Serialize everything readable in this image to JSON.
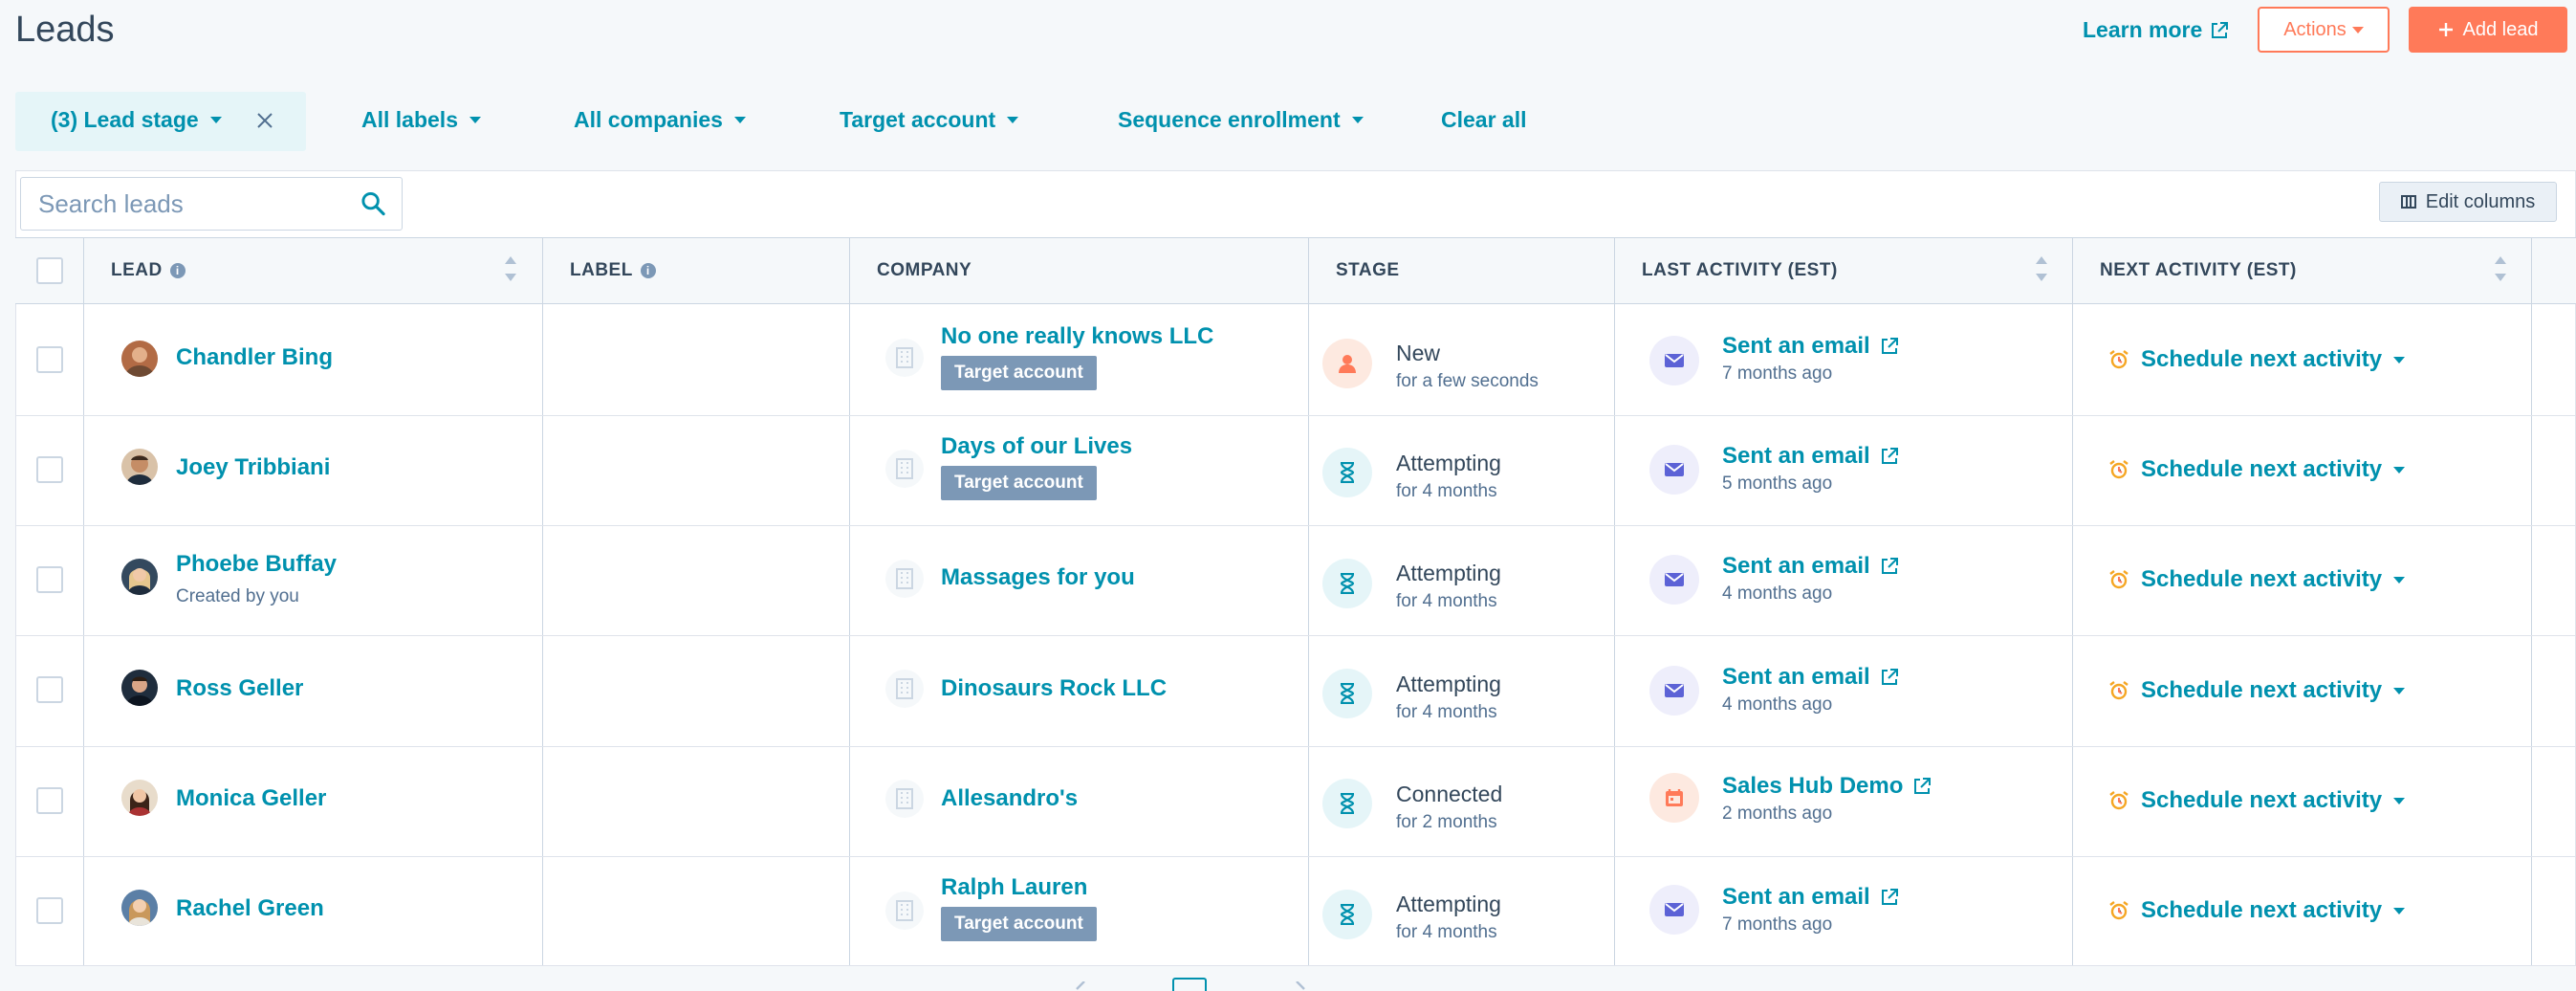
{
  "page": {
    "title": "Leads"
  },
  "header": {
    "learn_more": "Learn more",
    "actions": "Actions",
    "add_lead": "Add lead"
  },
  "filters": {
    "lead_stage": "(3) Lead stage",
    "all_labels": "All labels",
    "all_companies": "All companies",
    "target_account": "Target account",
    "sequence_enrollment": "Sequence enrollment",
    "clear_all": "Clear all"
  },
  "search": {
    "placeholder": "Search leads"
  },
  "toolbar": {
    "edit_columns": "Edit columns"
  },
  "columns": {
    "lead": "LEAD",
    "label": "LABEL",
    "company": "COMPANY",
    "stage": "STAGE",
    "last_activity": "LAST ACTIVITY (EST)",
    "next_activity": "NEXT ACTIVITY (EST)"
  },
  "colors": {
    "accent": "#0091ae",
    "brand": "#ff7a59",
    "tag": "#7c98b6"
  },
  "rows": [
    {
      "name": "Chandler Bing",
      "sub": "",
      "company": "No one really knows LLC",
      "tag": "Target account",
      "stage": "New",
      "stage_time": "for a few seconds",
      "stage_icon": "person-icon",
      "activity": "Sent an email",
      "activity_time": "7 months ago",
      "activity_icon": "email-icon",
      "next": "Schedule next activity"
    },
    {
      "name": "Joey Tribbiani",
      "sub": "",
      "company": "Days of our Lives",
      "tag": "Target account",
      "stage": "Attempting",
      "stage_time": "for 4 months",
      "stage_icon": "hourglass-icon",
      "activity": "Sent an email",
      "activity_time": "5 months ago",
      "activity_icon": "email-icon",
      "next": "Schedule next activity"
    },
    {
      "name": "Phoebe Buffay",
      "sub": "Created by you",
      "company": "Massages for you",
      "tag": "",
      "stage": "Attempting",
      "stage_time": "for 4 months",
      "stage_icon": "hourglass-icon",
      "activity": "Sent an email",
      "activity_time": "4 months ago",
      "activity_icon": "email-icon",
      "next": "Schedule next activity"
    },
    {
      "name": "Ross Geller",
      "sub": "",
      "company": "Dinosaurs Rock LLC",
      "tag": "",
      "stage": "Attempting",
      "stage_time": "for 4 months",
      "stage_icon": "hourglass-icon",
      "activity": "Sent an email",
      "activity_time": "4 months ago",
      "activity_icon": "email-icon",
      "next": "Schedule next activity"
    },
    {
      "name": "Monica Geller",
      "sub": "",
      "company": "Allesandro's",
      "tag": "",
      "stage": "Connected",
      "stage_time": "for 2 months",
      "stage_icon": "hourglass-icon",
      "activity": "Sales Hub Demo",
      "activity_time": "2 months ago",
      "activity_icon": "calendar-icon",
      "next": "Schedule next activity"
    },
    {
      "name": "Rachel Green",
      "sub": "",
      "company": "Ralph Lauren",
      "tag": "Target account",
      "stage": "Attempting",
      "stage_time": "for 4 months",
      "stage_icon": "hourglass-icon",
      "activity": "Sent an email",
      "activity_time": "7 months ago",
      "activity_icon": "email-icon",
      "next": "Schedule next activity"
    }
  ]
}
